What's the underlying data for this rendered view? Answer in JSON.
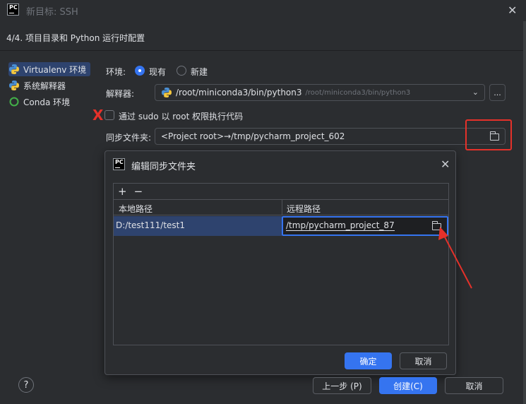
{
  "window": {
    "title": "新目标: SSH",
    "logo_text": "PC"
  },
  "step": {
    "label": "4/4. 项目目录和 Python 运行时配置"
  },
  "sidebar": {
    "items": [
      {
        "label": "Virtualenv 环境",
        "icon": "python-icon",
        "selected": true
      },
      {
        "label": "系统解释器",
        "icon": "python-icon",
        "selected": false
      },
      {
        "label": "Conda 环境",
        "icon": "conda-icon",
        "selected": false
      }
    ]
  },
  "env": {
    "label": "环境:",
    "options": [
      {
        "label": "现有",
        "selected": true
      },
      {
        "label": "新建",
        "selected": false
      }
    ]
  },
  "interpreter": {
    "label": "解释器:",
    "path": "/root/miniconda3/bin/python3",
    "hint": "/root/miniconda3/bin/python3",
    "more_button": "..."
  },
  "sudo": {
    "label": "通过 sudo 以 root 权限执行代码",
    "checked": false,
    "annotation_mark": "X"
  },
  "sync": {
    "label": "同步文件夹:",
    "value": "<Project root>→/tmp/pycharm_project_602"
  },
  "dialog": {
    "title": "编辑同步文件夹",
    "toolbar": {
      "add": "+",
      "remove": "−"
    },
    "columns": [
      "本地路径",
      "远程路径"
    ],
    "rows": [
      {
        "local": "D:/test111/test1",
        "remote": "/tmp/pycharm_project_87"
      }
    ],
    "ok": "确定",
    "cancel": "取消"
  },
  "footer": {
    "help": "?",
    "back": "上一步 (P)",
    "create": "创建(C)",
    "cancel": "取消"
  },
  "colors": {
    "accent": "#3574f0",
    "annotation": "#e5312a",
    "background": "#2b2d30"
  }
}
